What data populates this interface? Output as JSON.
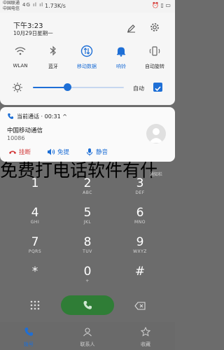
{
  "status_bar": {
    "carrier_1": "中国联通",
    "carrier_2": "中国电信",
    "signal": "4G ıl ıl",
    "netspeed": "1.73K/s",
    "icons": [
      "alarm-icon",
      "vibrate-icon",
      "battery-icon"
    ],
    "right_text": "⏰ ▯ ▭"
  },
  "quick_settings": {
    "time": "下午3:23",
    "date": "10月29日星期一",
    "tiles": [
      {
        "label": "WLAN",
        "icon": "wifi-icon",
        "active": false
      },
      {
        "label": "蓝牙",
        "icon": "bluetooth-icon",
        "active": false
      },
      {
        "label": "移动数据",
        "icon": "mobile-data-icon",
        "active": true
      },
      {
        "label": "响铃",
        "icon": "bell-icon",
        "active": true
      },
      {
        "label": "自动旋转",
        "icon": "rotate-icon",
        "active": false
      }
    ],
    "brightness_level": 0.38,
    "auto_label": "自动",
    "auto_checked": true
  },
  "call_card": {
    "status": "当前通话 · 00:31 ^",
    "caller_name": "中国移动通信",
    "caller_number": "10086",
    "hangup_label": "挂断",
    "speaker_label": "免提",
    "mute_label": "静音"
  },
  "overlay_text": "免费打电话软件有什",
  "watermark": "通知栏",
  "dialpad": {
    "keys": [
      {
        "digit": "1",
        "letters": ""
      },
      {
        "digit": "2",
        "letters": "ABC"
      },
      {
        "digit": "3",
        "letters": "DEF"
      },
      {
        "digit": "4",
        "letters": "GHI"
      },
      {
        "digit": "5",
        "letters": "JKL"
      },
      {
        "digit": "6",
        "letters": "MNO"
      },
      {
        "digit": "7",
        "letters": "PQRS"
      },
      {
        "digit": "8",
        "letters": "TUV"
      },
      {
        "digit": "9",
        "letters": "WXYZ"
      },
      {
        "digit": "*",
        "letters": ""
      },
      {
        "digit": "0",
        "letters": "+"
      },
      {
        "digit": "#",
        "letters": ""
      }
    ]
  },
  "tabs": [
    {
      "label": "拨号",
      "icon": "phone-icon",
      "active": true
    },
    {
      "label": "联系人",
      "icon": "contacts-icon",
      "active": false
    },
    {
      "label": "收藏",
      "icon": "star-icon",
      "active": false
    }
  ],
  "colors": {
    "accent": "#1e6fd6",
    "call_green": "#2f7d36",
    "dim_background": "#6c6c6c"
  }
}
